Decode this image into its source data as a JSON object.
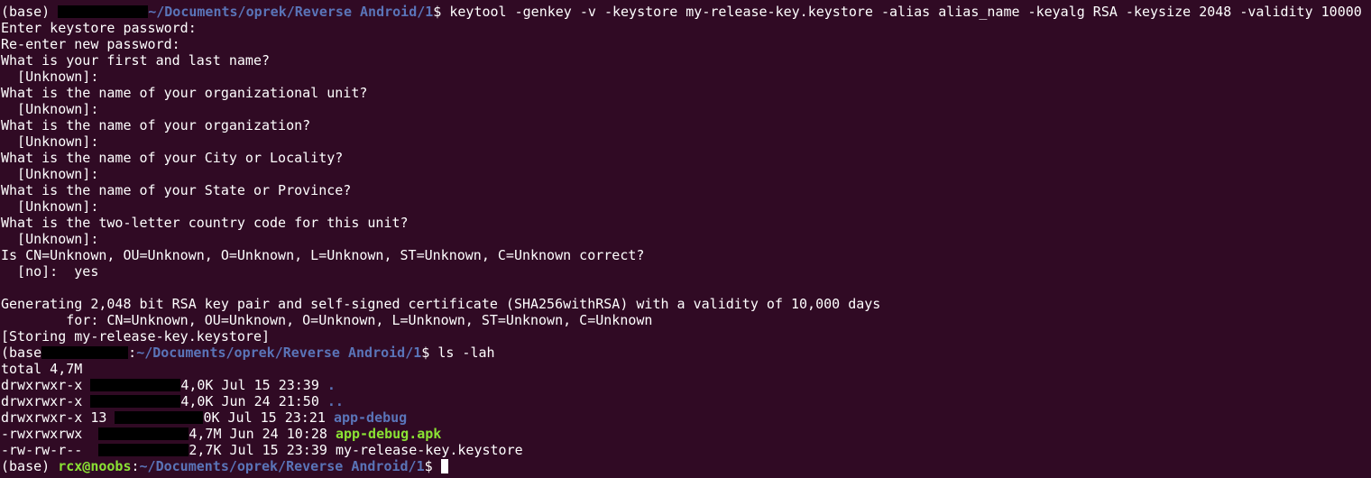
{
  "window": {
    "background": "#300a24",
    "colors": {
      "text": "#ffffff",
      "user_host": "#8ae234",
      "path": "#5a74b8",
      "dir": "#5a74b8",
      "exec": "#8ae234",
      "redact": "#000000"
    }
  },
  "prompt": {
    "env": "(base)",
    "user_host": "rcx@noobs",
    "separator": ":",
    "path": "~/Documents/oprek/Reverse Android/1",
    "symbol": "$"
  },
  "session": {
    "cmd1": "keytool -genkey -v -keystore my-release-key.keystore -alias alias_name -keyalg RSA -keysize 2048 -validity 10000",
    "output1": [
      "Enter keystore password:",
      "Re-enter new password:",
      "What is your first and last name?",
      "  [Unknown]:",
      "What is the name of your organizational unit?",
      "  [Unknown]:",
      "What is the name of your organization?",
      "  [Unknown]:",
      "What is the name of your City or Locality?",
      "  [Unknown]:",
      "What is the name of your State or Province?",
      "  [Unknown]:",
      "What is the two-letter country code for this unit?",
      "  [Unknown]:",
      "Is CN=Unknown, OU=Unknown, O=Unknown, L=Unknown, ST=Unknown, C=Unknown correct?",
      "  [no]:  yes",
      "",
      "Generating 2,048 bit RSA key pair and self-signed certificate (SHA256withRSA) with a validity of 10,000 days",
      "        for: CN=Unknown, OU=Unknown, O=Unknown, L=Unknown, ST=Unknown, C=Unknown",
      "[Storing my-release-key.keystore]"
    ],
    "cmd2": "ls -lah",
    "ls_total": "total 4,7M",
    "ls_rows": [
      {
        "perms": "drwxrwxr-x",
        "links": "",
        "size_tail": "4,0K",
        "date": "Jul 15 23:39",
        "name": ".",
        "kind": "dir"
      },
      {
        "perms": "drwxrwxr-x",
        "links": "",
        "size_tail": "4,0K",
        "date": "Jun 24 21:50",
        "name": "..",
        "kind": "dir"
      },
      {
        "perms": "drwxrwxr-x",
        "links": "13",
        "size_tail": "0K",
        "date": "Jul 15 23:21",
        "name": "app-debug",
        "kind": "dir"
      },
      {
        "perms": "-rwxrwxrwx",
        "links": "",
        "size_tail": "4,7M",
        "date": "Jun 24 10:28",
        "name": "app-debug.apk",
        "kind": "exec"
      },
      {
        "perms": "-rw-rw-r--",
        "links": "",
        "size_tail": "2,7K",
        "date": "Jul 15 23:39",
        "name": "my-release-key.keystore",
        "kind": "file"
      }
    ]
  }
}
